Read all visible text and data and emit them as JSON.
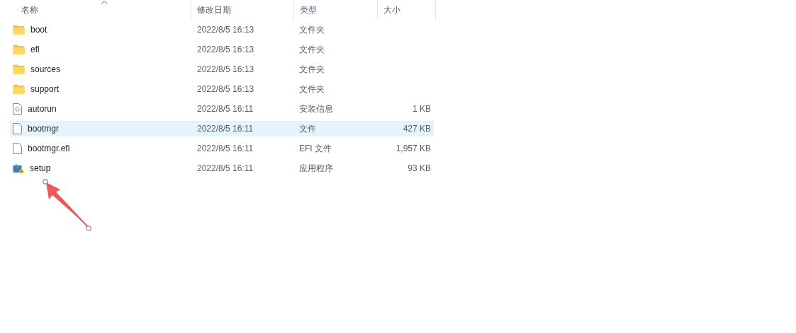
{
  "columns": [
    {
      "label": "名称",
      "sorted": true
    },
    {
      "label": "修改日期",
      "sorted": false
    },
    {
      "label": "类型",
      "sorted": false
    },
    {
      "label": "大小",
      "sorted": false
    }
  ],
  "rows": [
    {
      "kind": "folder",
      "name": "boot",
      "date": "2022/8/5 16:13",
      "type": "文件夹",
      "size": "",
      "selected": false
    },
    {
      "kind": "folder",
      "name": "efi",
      "date": "2022/8/5 16:13",
      "type": "文件夹",
      "size": "",
      "selected": false
    },
    {
      "kind": "folder",
      "name": "sources",
      "date": "2022/8/5 16:13",
      "type": "文件夹",
      "size": "",
      "selected": false
    },
    {
      "kind": "folder",
      "name": "support",
      "date": "2022/8/5 16:13",
      "type": "文件夹",
      "size": "",
      "selected": false
    },
    {
      "kind": "settings",
      "name": "autorun",
      "date": "2022/8/5 16:11",
      "type": "安装信息",
      "size": "1 KB",
      "selected": false
    },
    {
      "kind": "file",
      "name": "bootmgr",
      "date": "2022/8/5 16:11",
      "type": "文件",
      "size": "427 KB",
      "selected": true
    },
    {
      "kind": "file",
      "name": "bootmgr.efi",
      "date": "2022/8/5 16:11",
      "type": "EFI 文件",
      "size": "1,957 KB",
      "selected": false
    },
    {
      "kind": "app",
      "name": "setup",
      "date": "2022/8/5 16:11",
      "type": "应用程序",
      "size": "93 KB",
      "selected": false
    }
  ]
}
